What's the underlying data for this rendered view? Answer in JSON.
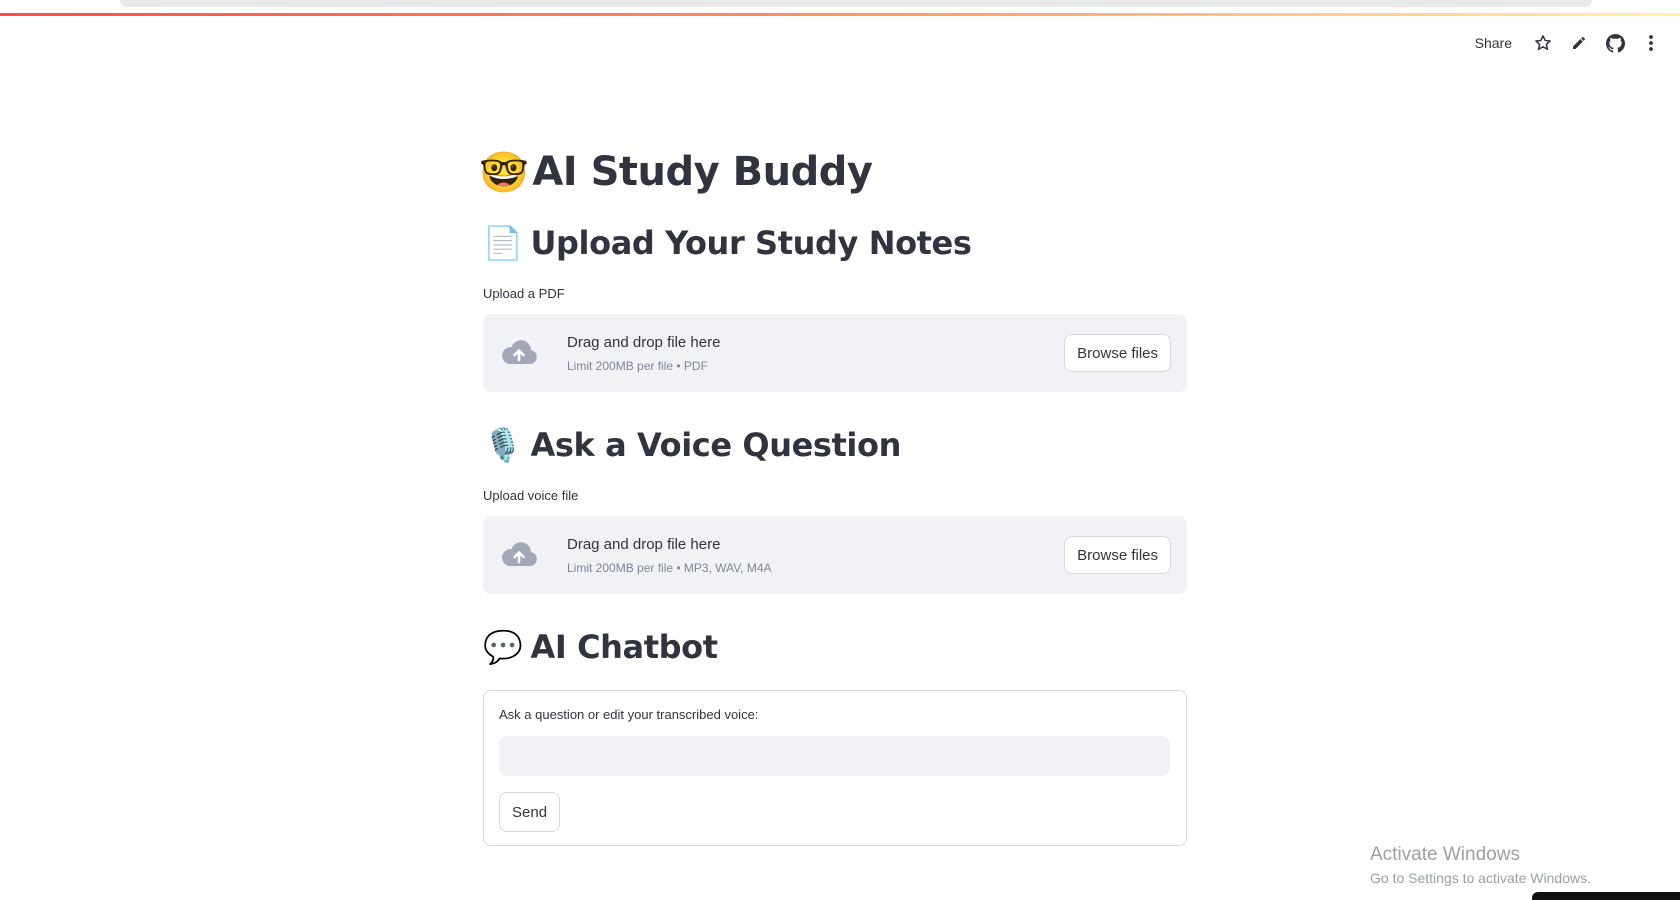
{
  "toolbar": {
    "share_label": "Share",
    "icons": [
      "star-icon",
      "pencil-icon",
      "github-icon",
      "more-vertical-icon"
    ]
  },
  "app": {
    "title_emoji": "🤓",
    "title": "AI Study Buddy"
  },
  "pdf_section": {
    "emoji": "📄",
    "heading": "Upload Your Study Notes",
    "uploader_label": "Upload a PDF",
    "drop_text": "Drag and drop file here",
    "limit_text": "Limit 200MB per file • PDF",
    "browse_label": "Browse files"
  },
  "voice_section": {
    "emoji": "🎙️",
    "heading": "Ask a Voice Question",
    "uploader_label": "Upload voice file",
    "drop_text": "Drag and drop file here",
    "limit_text": "Limit 200MB per file • MP3, WAV, M4A",
    "browse_label": "Browse files"
  },
  "chat_section": {
    "emoji": "💬",
    "heading": "AI Chatbot",
    "input_label": "Ask a question or edit your transcribed voice:",
    "input_value": "",
    "send_label": "Send"
  },
  "os_watermark": {
    "line1": "Activate Windows",
    "line2": "Go to Settings to activate Windows."
  },
  "colors": {
    "accent": "#ff4b4b",
    "text": "#31333f",
    "muted": "#808495",
    "dropzone_bg": "#f0f2f6",
    "border": "#d5d8de"
  }
}
